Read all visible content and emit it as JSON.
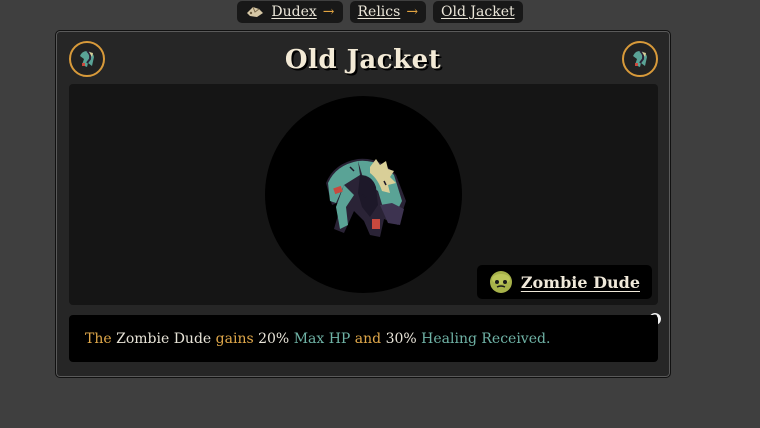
{
  "breadcrumb": {
    "items": [
      {
        "label": "Dudex",
        "icon": "dudex-icon"
      },
      {
        "label": "Relics"
      },
      {
        "label": "Old Jacket"
      }
    ],
    "separator": "→"
  },
  "relic": {
    "title": "Old Jacket",
    "icon": "old-jacket-icon",
    "owner": {
      "name": "Zombie Dude",
      "icon": "zombie-dude-icon"
    },
    "description": {
      "w1": "The",
      "w2": "Zombie Dude",
      "w3": "gains",
      "w4": "20%",
      "w5": "Max HP",
      "w6": "and",
      "w7": "30%",
      "w8": "Healing Received",
      "w9": "."
    },
    "help_label": "?"
  },
  "colors": {
    "background": "#3f3f3f",
    "card": "#262626",
    "accent_gold": "#e0a84a",
    "accent_teal": "#6fb3a6",
    "corner_ring": "#d89a3a"
  }
}
